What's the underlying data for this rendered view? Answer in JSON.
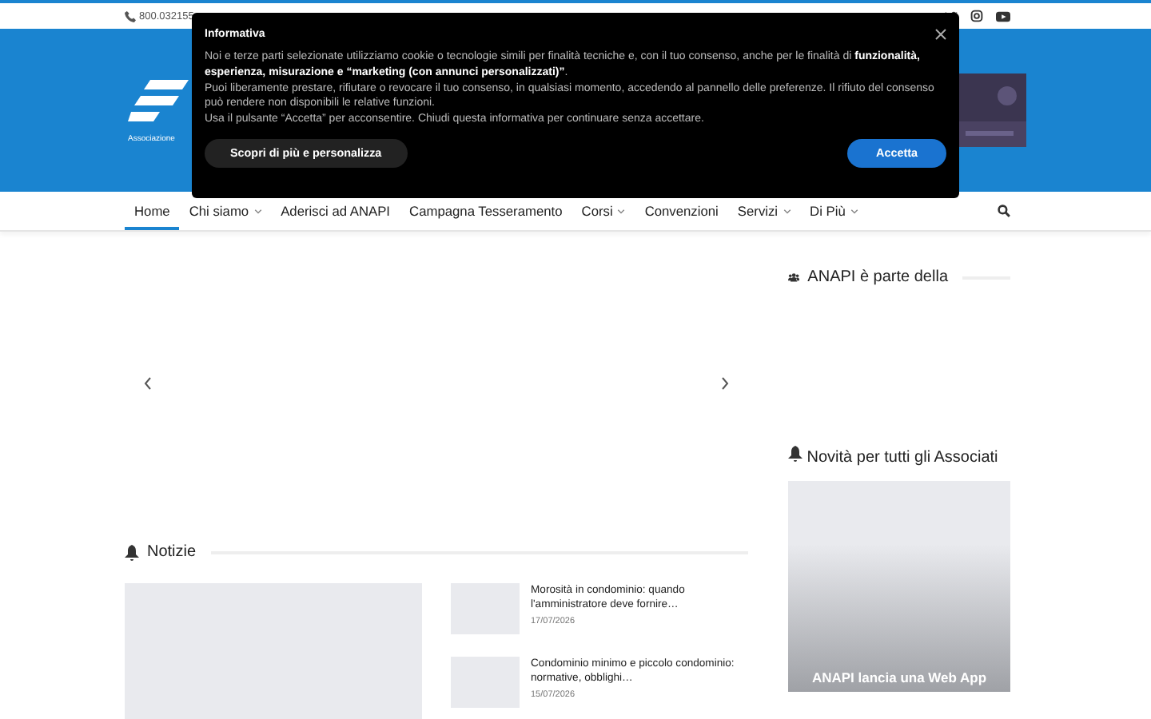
{
  "topbar": {
    "phone": "800.032155"
  },
  "header": {
    "logo_tagline": "Associazione"
  },
  "nav": {
    "items": [
      {
        "label": "Home",
        "selected": true,
        "dropdown": false
      },
      {
        "label": "Chi siamo",
        "selected": false,
        "dropdown": true
      },
      {
        "label": "Aderisci ad ANAPI",
        "selected": false,
        "dropdown": false
      },
      {
        "label": "Campagna Tesseramento",
        "selected": false,
        "dropdown": false
      },
      {
        "label": "Corsi",
        "selected": false,
        "dropdown": true
      },
      {
        "label": "Convenzioni",
        "selected": false,
        "dropdown": false
      },
      {
        "label": "Servizi",
        "selected": false,
        "dropdown": true
      },
      {
        "label": "Di Più",
        "selected": false,
        "dropdown": true
      }
    ]
  },
  "news": {
    "title": "Notizie",
    "items": [
      {
        "title": "Morosità in condominio: quando l'amministratore deve fornire…",
        "date": "17/07/2026"
      },
      {
        "title": "Condominio minimo e piccolo condominio: normative, obblighi…",
        "date": "15/07/2026"
      }
    ]
  },
  "sidebar": {
    "partner_title": "ANAPI è parte della",
    "promo_title": "Novità per tutti gli Associati",
    "promo_card_title": "ANAPI lancia una Web App"
  },
  "cookie_dialog": {
    "title": "Informativa",
    "paragraphs": [
      "Noi e terze parti selezionate utilizziamo cookie o tecnologie simili per finalità tecniche e, con il tuo consenso, anche per le finalità di **funzionalità, esperienza, misurazione e “marketing (con annunci personalizzati)”**.",
      "Puoi liberamente prestare, rifiutare o revocare il tuo consenso, in qualsiasi momento, accedendo al pannello delle preferenze. Il rifiuto del consenso può rendere non disponibili le relative funzioni.",
      "Usa il pulsante “Accetta” per acconsentire. Chiudi questa informativa per continuare senza accettare."
    ],
    "customize_button": "Scopri di più e personalizza",
    "accept_button": "Accetta"
  }
}
